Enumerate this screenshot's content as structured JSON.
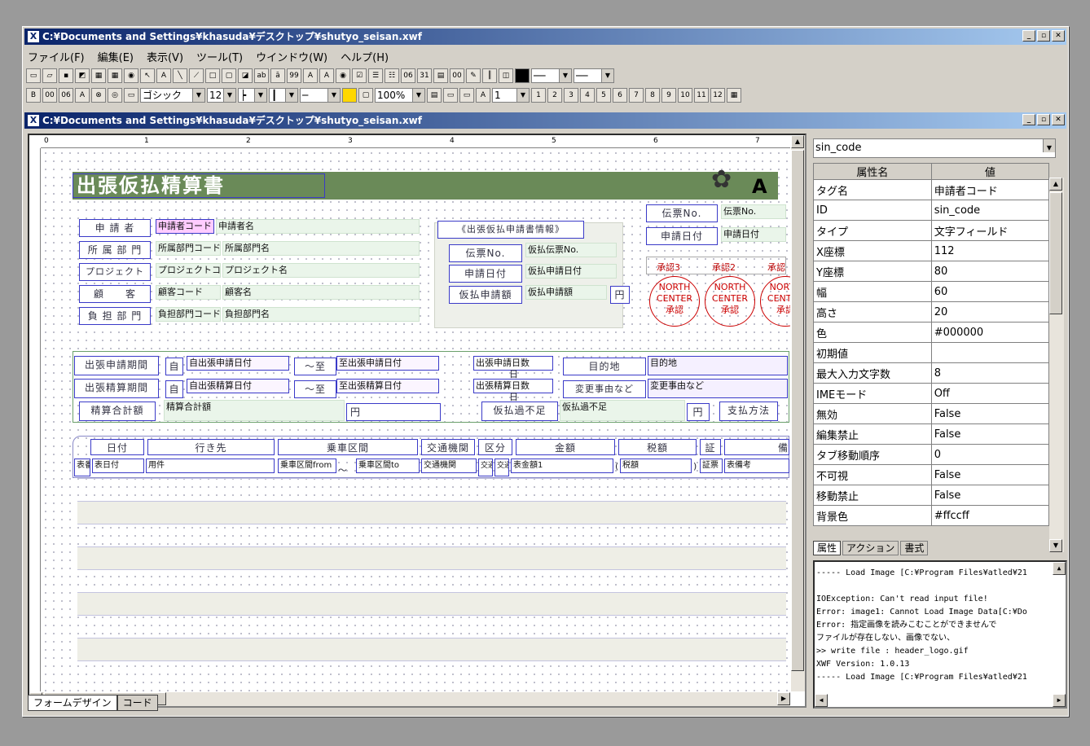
{
  "app": {
    "title": "C:¥Documents and Settings¥khasuda¥デスクトップ¥shutyo_seisan.xwf",
    "doc_title": "C:¥Documents and Settings¥khasuda¥デスクトップ¥shutyo_seisan.xwf"
  },
  "menu": [
    "ファイル(F)",
    "編集(E)",
    "表示(V)",
    "ツール(T)",
    "ウインドウ(W)",
    "ヘルプ(H)"
  ],
  "toolbar": {
    "font": "ゴシック",
    "size": "12",
    "zoom": "100%",
    "page": "1"
  },
  "form": {
    "title": "出張仮払精算書",
    "labels": {
      "applicant": "申 請 者",
      "dept": "所 属 部 門",
      "project": "プロジェクト",
      "customer": "顧　　客",
      "burden": "負 担 部 門",
      "info": "《出張仮払申請書情報》",
      "voucher": "伝票No.",
      "apply_date": "申請日付",
      "voucher2": "伝票No.",
      "apply_date2": "申請日付",
      "advance_amt": "仮払申請額",
      "yen": "円",
      "trip_period": "出張申請期間",
      "settle_period": "出張精算期間",
      "total": "精算合計額",
      "shortage": "仮払過不足",
      "yen2": "円",
      "yen3": "円",
      "pay_method": "支払方法",
      "from": "自",
      "to": "～至",
      "from2": "自",
      "to2": "～至",
      "dest": "目的地",
      "change": "変更事由など",
      "days": "日",
      "days2": "日"
    },
    "fields": {
      "applicant_code": "申請者コード",
      "applicant_name": "申請者名",
      "dept_code": "所属部門コード",
      "dept_name": "所属部門名",
      "proj_code": "プロジェクトコード",
      "proj_name": "プロジェクト名",
      "cust_code": "顧客コード",
      "cust_name": "顧客名",
      "burden_code": "負担部門コード",
      "burden_name": "負担部門名",
      "adv_voucher": "仮払伝票No.",
      "adv_date": "仮払申請日付",
      "adv_amt": "仮払申請額",
      "voucher_no": "伝票No.",
      "apply_date": "申請日付",
      "trip_from": "自出張申請日付",
      "trip_to": "至出張申請日付",
      "trip_days": "出張申請日数",
      "settle_from": "自出張精算日付",
      "settle_to": "至出張精算日付",
      "settle_days": "出張精算日数",
      "dest": "目的地",
      "change": "変更事由など",
      "total": "精算合計額",
      "shortage": "仮払過不足"
    },
    "approvals": [
      "承認3",
      "承認2",
      "承認"
    ],
    "stamp_text": [
      "NORTH",
      "CENTER",
      "承認"
    ],
    "table_headers": [
      "日付",
      "行き先",
      "乗車区間",
      "交通機関",
      "区分",
      "金額",
      "税額",
      "証",
      "備"
    ],
    "table_fields": [
      "表番",
      "表日付",
      "用件",
      "乗車区間from",
      "～",
      "乗車区間to",
      "交通機関",
      "交通",
      "交通",
      "表金額1",
      "(",
      "税額",
      ")",
      "証票",
      "表備考"
    ],
    "logo": "A"
  },
  "tabs": {
    "design": "フォームデザイン",
    "code": "コード"
  },
  "props": {
    "selector": "sin_code",
    "header": [
      "属性名",
      "値"
    ],
    "rows": [
      [
        "タグ名",
        "申請者コード"
      ],
      [
        "ID",
        "sin_code"
      ],
      [
        "タイプ",
        "文字フィールド"
      ],
      [
        "X座標",
        "112"
      ],
      [
        "Y座標",
        "80"
      ],
      [
        "幅",
        "60"
      ],
      [
        "高さ",
        "20"
      ],
      [
        "色",
        "#000000"
      ],
      [
        "初期値",
        ""
      ],
      [
        "最大入力文字数",
        "8"
      ],
      [
        "IMEモード",
        "Off"
      ],
      [
        "無効",
        "False"
      ],
      [
        "編集禁止",
        "False"
      ],
      [
        "タブ移動順序",
        "0"
      ],
      [
        "不可視",
        "False"
      ],
      [
        "移動禁止",
        "False"
      ],
      [
        "背景色",
        "#ffccff"
      ]
    ],
    "tabs": [
      "属性",
      "アクション",
      "書式"
    ]
  },
  "log": [
    "----- Load Image [C:¥Program Files¥atled¥21",
    "",
    "IOException: Can't read input file!",
    "Error: image1: Cannot Load Image Data[C:¥Do",
    "Error: 指定画像を読みこむことができませんで",
    "      ファイルが存在しない、画像でない、",
    "&gt;&gt; write file : header_logo.gif",
    "XWF Version: 1.0.13",
    "----- Load Image [C:¥Program Files¥atled¥21"
  ],
  "ruler": [
    "0",
    "1",
    "2",
    "3",
    "4",
    "5",
    "6",
    "7"
  ]
}
